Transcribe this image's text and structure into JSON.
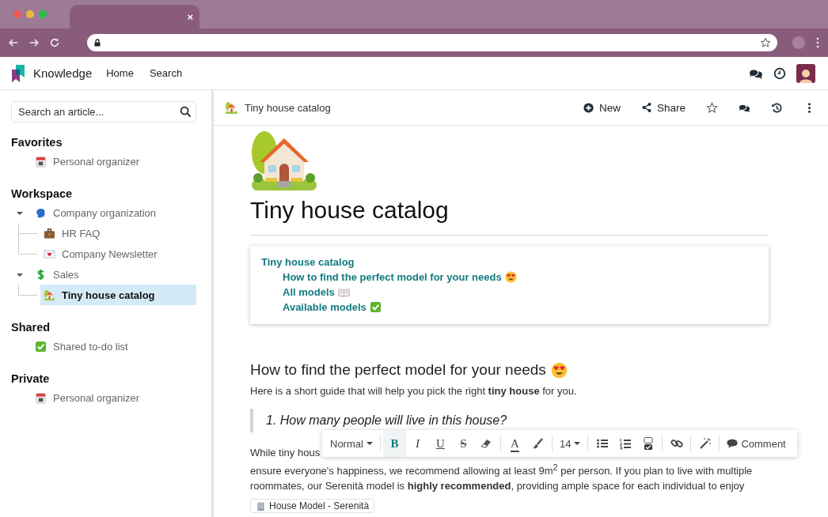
{
  "browser": {
    "tab": {
      "close": "×"
    }
  },
  "navbar": {
    "app_name": "Knowledge",
    "menu": [
      {
        "label": "Home"
      },
      {
        "label": "Search"
      }
    ]
  },
  "sidebar": {
    "search": {
      "placeholder": "Search an article..."
    },
    "sections": [
      {
        "title": "Favorites",
        "items": [
          {
            "label": "Personal organizer",
            "kind": "calendar",
            "selected": false
          }
        ]
      },
      {
        "title": "Workspace",
        "items": [
          {
            "label": "Company organization",
            "kind": "head",
            "selected": false,
            "expanded": true,
            "children": [
              {
                "label": "HR FAQ",
                "kind": "briefcase",
                "selected": false
              },
              {
                "label": "Company Newsletter",
                "kind": "letter",
                "selected": false
              }
            ]
          },
          {
            "label": "Sales",
            "kind": "dollar",
            "selected": false,
            "expanded": true,
            "children": [
              {
                "label": "Tiny house catalog",
                "kind": "house",
                "selected": true
              }
            ]
          }
        ]
      },
      {
        "title": "Shared",
        "items": [
          {
            "label": "Shared to-do list",
            "kind": "check",
            "selected": false
          }
        ]
      },
      {
        "title": "Private",
        "items": [
          {
            "label": "Personal organizer",
            "kind": "calendar",
            "selected": false
          }
        ]
      }
    ]
  },
  "header": {
    "breadcrumb": {
      "title": "Tiny house catalog",
      "kind": "house"
    },
    "actions": [
      {
        "kind": "new",
        "label": "New"
      },
      {
        "kind": "share",
        "label": "Share"
      },
      {
        "kind": "star"
      },
      {
        "kind": "chat"
      },
      {
        "kind": "history"
      },
      {
        "kind": "more"
      }
    ]
  },
  "article": {
    "cover": {
      "kind": "house"
    },
    "title": "Tiny house catalog",
    "toc": [
      {
        "label": "Tiny house catalog",
        "children": [
          {
            "label": "How to find the perfect model for your needs",
            "kind": "heart-eyes"
          },
          {
            "label": "All models",
            "kind": "book"
          },
          {
            "label": "Available models",
            "kind": "check"
          }
        ]
      }
    ],
    "section": {
      "heading": "How to find the perfect model for your needs",
      "kind": "heart-eyes",
      "intro": "Here is a short guide that will help you pick the right **tiny house** for you.",
      "quote": "1. How many people will live in this house?",
      "paragraph": [
        "While tiny hous",
        "ensure everyone's happiness, we recommend allowing at least 9m$^{2}$ per person. If you plan to live with multiple",
        "roommates, our Serenità model is **highly recommended**, providing ample space for each individual to enjoy"
      ],
      "chip": {
        "label": "House Model - Serenità",
        "kind": "building"
      }
    }
  },
  "toolbar": {
    "items": [
      {
        "kind": "dropdown",
        "label": "Normal"
      },
      {
        "kind": "separator"
      },
      {
        "kind": "bold",
        "label": "B",
        "active": true
      },
      {
        "kind": "italic",
        "label": "I",
        "active": false
      },
      {
        "kind": "underline",
        "label": "U",
        "active": false
      },
      {
        "kind": "strike",
        "label": "S",
        "active": false
      },
      {
        "kind": "eraser"
      },
      {
        "kind": "separator"
      },
      {
        "kind": "text-color",
        "label": "A"
      },
      {
        "kind": "brush"
      },
      {
        "kind": "separator"
      },
      {
        "kind": "dropdown",
        "label": "14"
      },
      {
        "kind": "separator"
      },
      {
        "kind": "bullet-list"
      },
      {
        "kind": "numbered-list"
      },
      {
        "kind": "checklist"
      },
      {
        "kind": "separator"
      },
      {
        "kind": "link"
      },
      {
        "kind": "separator"
      },
      {
        "kind": "magic"
      },
      {
        "kind": "separator"
      },
      {
        "kind": "comment",
        "label": "Comment"
      }
    ]
  }
}
